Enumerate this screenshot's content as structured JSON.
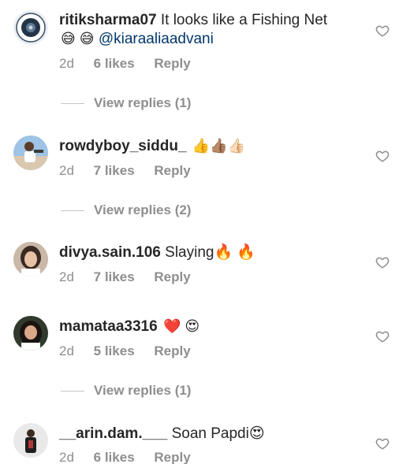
{
  "comments": [
    {
      "username": "ritiksharma07",
      "text": "It looks like a Fishing Net",
      "second_line_emoji": "😅 😅",
      "mention": "@kiaraaliaadvani",
      "time": "2d",
      "likes": "6 likes",
      "reply": "Reply",
      "view_replies": "View replies (1)"
    },
    {
      "username": "rowdyboy_siddu_",
      "text": "👍👍🏽👍🏻",
      "time": "2d",
      "likes": "7 likes",
      "reply": "Reply",
      "view_replies": "View replies (2)"
    },
    {
      "username": "divya.sain.106",
      "text": "Slaying🔥 🔥",
      "time": "2d",
      "likes": "7 likes",
      "reply": "Reply"
    },
    {
      "username": "mamataa3316",
      "text": "❤️ 😍",
      "time": "2d",
      "likes": "5 likes",
      "reply": "Reply",
      "view_replies": "View replies (1)"
    },
    {
      "username": "__arin.dam.___",
      "text": "Soan Papdi😍",
      "time": "2d",
      "likes": "6 likes",
      "reply": "Reply"
    }
  ]
}
